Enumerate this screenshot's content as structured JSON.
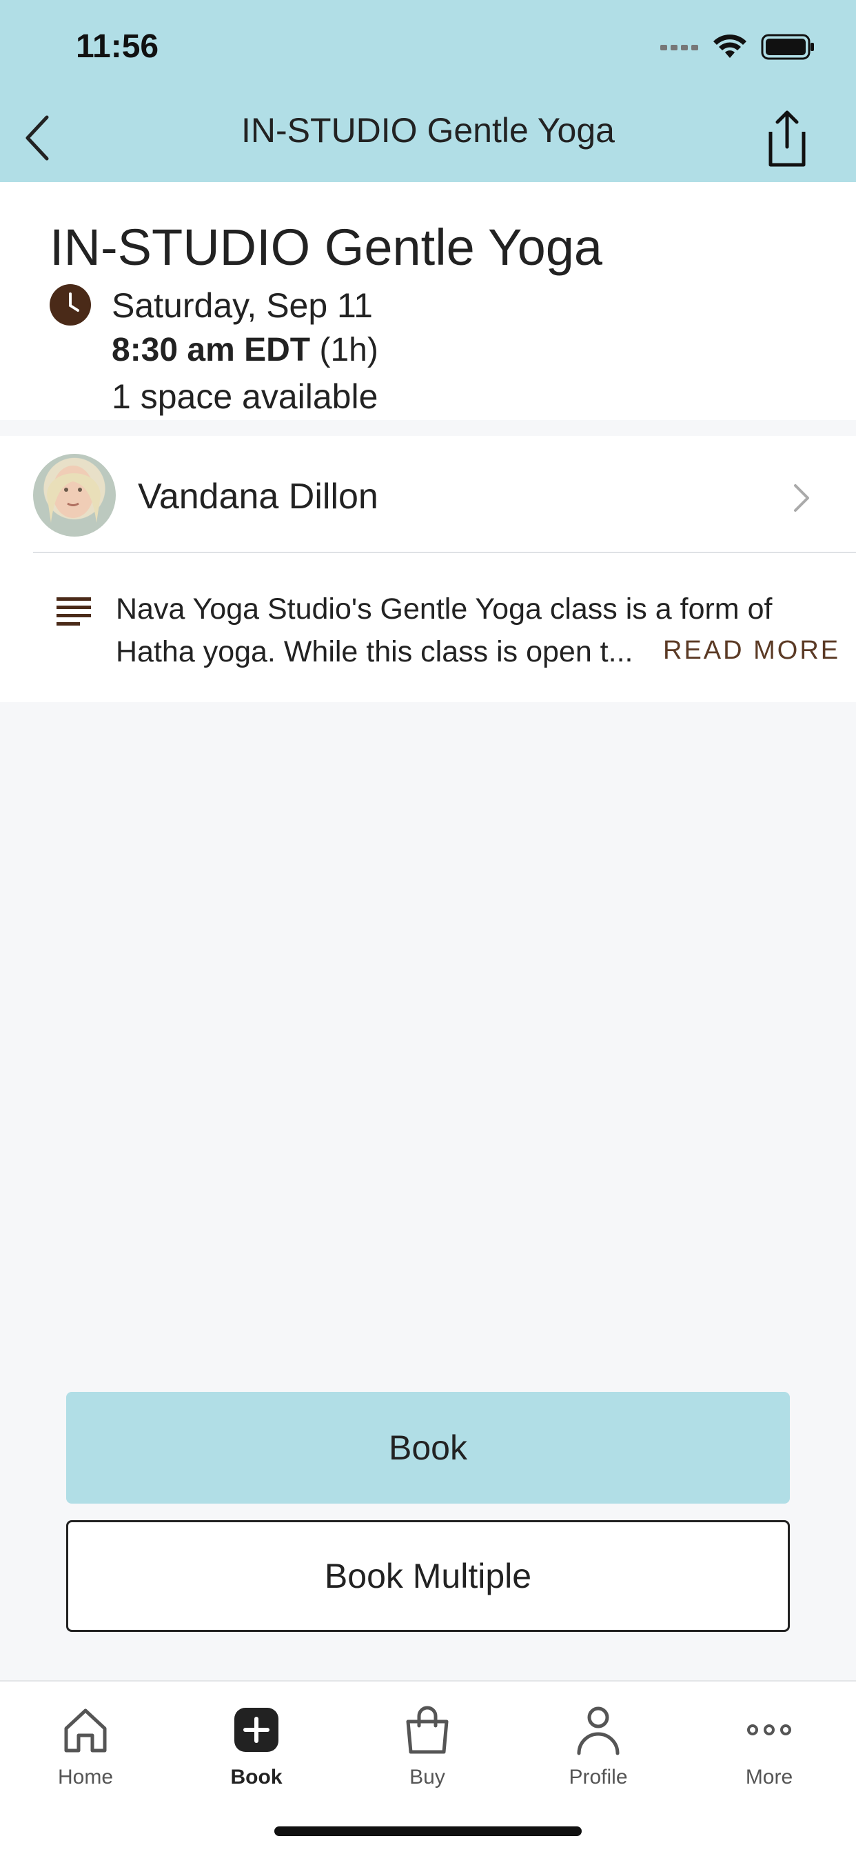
{
  "status_bar": {
    "time": "11:56"
  },
  "nav": {
    "title": "IN-STUDIO Gentle Yoga"
  },
  "class_info": {
    "title": "IN-STUDIO Gentle Yoga",
    "date": "Saturday, Sep 11",
    "time": "8:30 am EDT",
    "duration": "(1h)",
    "availability": "1 space available"
  },
  "instructor": {
    "name": "Vandana Dillon"
  },
  "description": {
    "line1": "Nava Yoga Studio's Gentle Yoga class is a form of",
    "line2": "Hatha yoga. While this class is open t...",
    "read_more": "READ MORE"
  },
  "actions": {
    "book": "Book",
    "book_multiple": "Book Multiple"
  },
  "tabs": [
    {
      "label": "Home",
      "icon": "home-icon"
    },
    {
      "label": "Book",
      "icon": "plus-square-icon"
    },
    {
      "label": "Buy",
      "icon": "bag-icon"
    },
    {
      "label": "Profile",
      "icon": "person-icon"
    },
    {
      "label": "More",
      "icon": "ellipsis-icon"
    }
  ],
  "colors": {
    "header": "#b1dee6",
    "accent_brown": "#4a2a18",
    "book_button": "#b1dee6"
  }
}
